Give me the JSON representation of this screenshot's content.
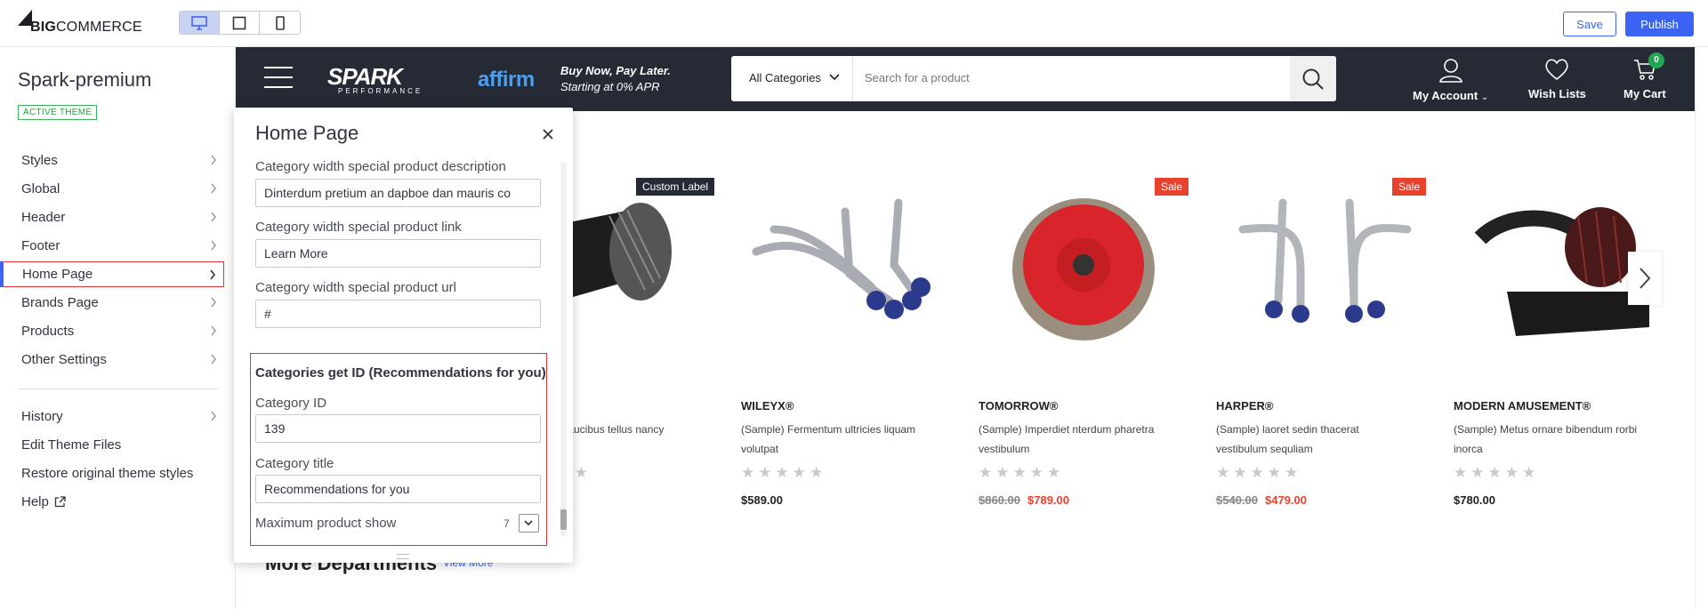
{
  "topbar": {
    "logo_text_bold": "BIG",
    "logo_text_rest": "COMMERCE",
    "devices": [
      "desktop",
      "tablet",
      "mobile"
    ],
    "active_device": "desktop",
    "save_label": "Save",
    "publish_label": "Publish",
    "accent": "#3c64f4"
  },
  "sidebar": {
    "theme_name": "Spark-premium",
    "theme_badge": "ACTIVE THEME",
    "items": [
      {
        "label": "Styles",
        "chevron": true
      },
      {
        "label": "Global",
        "chevron": true
      },
      {
        "label": "Header",
        "chevron": true
      },
      {
        "label": "Footer",
        "chevron": true
      },
      {
        "label": "Home Page",
        "chevron": true,
        "selected": true
      },
      {
        "label": "Brands Page",
        "chevron": true
      },
      {
        "label": "Products",
        "chevron": true
      },
      {
        "label": "Other Settings",
        "chevron": true
      }
    ],
    "bottom_items": [
      {
        "label": "History",
        "chevron": true
      },
      {
        "label": "Edit Theme Files"
      },
      {
        "label": "Restore original theme styles"
      },
      {
        "label": "Help",
        "external": true
      }
    ]
  },
  "store": {
    "logo_main": "SPARK",
    "logo_sub": "PERFORMANCE",
    "affirm": "affirm",
    "bnpl_line1": "Buy Now, Pay Later.",
    "bnpl_line2": "Starting at 0% APR",
    "category_select": "All Categories",
    "search_placeholder": "Search for a product",
    "account_label": "My Account",
    "wishlist_label": "Wish Lists",
    "cart_label": "My Cart",
    "cart_count": "0",
    "header_bg": "#262a35",
    "products": [
      {
        "badge": "Custom Label",
        "badge_type": "custom",
        "brand": "",
        "name": "faucibus tellus nancy",
        "price": "",
        "old_price": ""
      },
      {
        "badge": "",
        "brand": "WILEYX®",
        "name": "(Sample) Fermentum ultricies liquam volutpat",
        "price": "$589.00",
        "old_price": ""
      },
      {
        "badge": "Sale",
        "badge_type": "sale",
        "brand": "TOMORROW®",
        "name": "(Sample) Imperdiet nterdum pharetra vestibulum",
        "price": "$789.00",
        "old_price": "$860.00"
      },
      {
        "badge": "Sale",
        "badge_type": "sale",
        "brand": "HARPER®",
        "name": "(Sample) laoret sedin thacerat vestibulum sequliam",
        "price": "$479.00",
        "old_price": "$540.00"
      },
      {
        "badge": "",
        "brand": "MODERN AMUSEMENT®",
        "name": "(Sample) Metus ornare bibendum rorbi inorca",
        "price": "$780.00",
        "old_price": ""
      }
    ],
    "section_title": "More Departments",
    "view_more": "View More"
  },
  "panel": {
    "title": "Home Page",
    "fields": {
      "desc_label": "Category width special product description",
      "desc_value": "Dinterdum pretium an dapboe dan mauris co",
      "link_label": "Category width special product link",
      "link_value": "Learn More",
      "url_label": "Category width special product url",
      "url_value": "#"
    },
    "rec_group": {
      "title": "Categories get ID (Recommendations for you)",
      "id_label": "Category ID",
      "id_value": "139",
      "cat_title_label": "Category title",
      "cat_title_value": "Recommendations for you",
      "max_label": "Maximum product show",
      "max_value": "7"
    }
  }
}
